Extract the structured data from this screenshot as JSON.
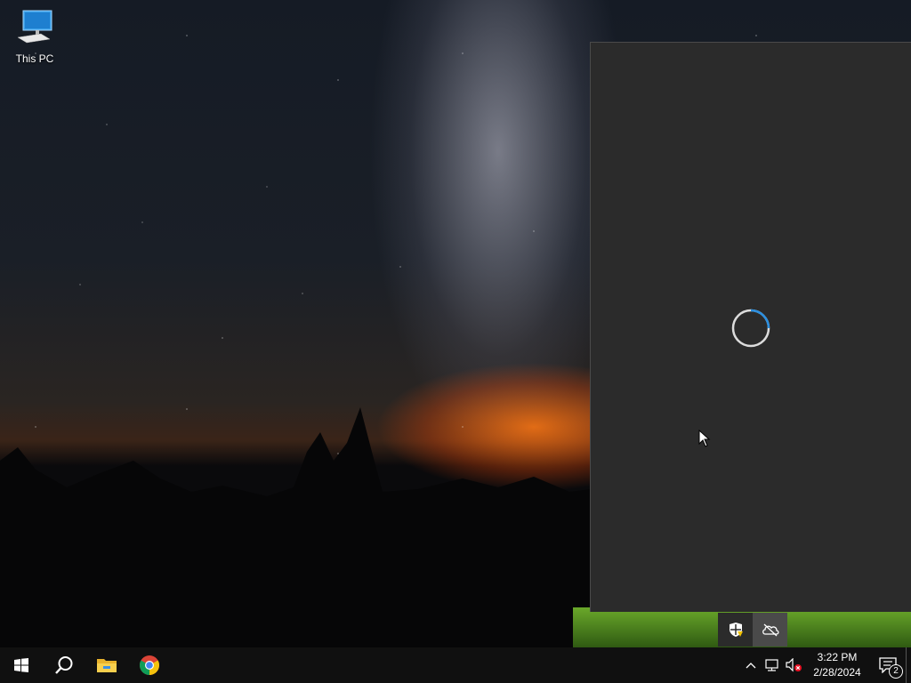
{
  "desktop": {
    "icons": [
      {
        "label": "This PC",
        "icon": "this-pc-icon"
      }
    ]
  },
  "flyout": {
    "state": "loading",
    "spinner_color": "#0078d7"
  },
  "tray_popup": {
    "items": [
      {
        "icon": "windows-security-warning-icon"
      },
      {
        "icon": "onedrive-offline-icon"
      }
    ]
  },
  "taskbar": {
    "start_icon": "windows-start-icon",
    "pinned": [
      {
        "icon": "search-icon"
      },
      {
        "icon": "file-explorer-icon"
      },
      {
        "icon": "chrome-icon"
      }
    ],
    "tray": {
      "chevron_icon": "chevron-up-icon",
      "network_icon": "network-disconnected-icon",
      "volume_icon": "volume-muted-icon",
      "time": "3:22 PM",
      "date": "2/28/2024",
      "notification_count": "2"
    }
  },
  "colors": {
    "taskbar_bg": "#101010",
    "flyout_bg": "#2b2b2b",
    "accent": "#0078d7"
  }
}
